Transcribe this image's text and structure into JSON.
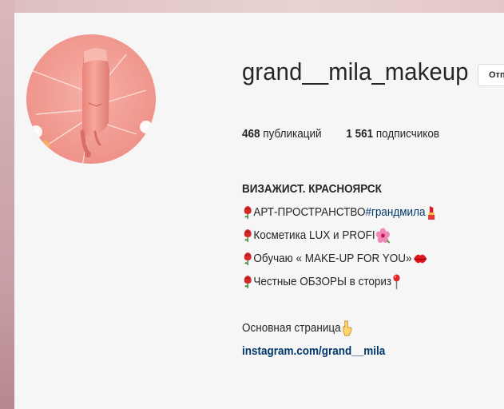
{
  "profile": {
    "username": "grand__mila_makeup",
    "message_button_label": "Отп"
  },
  "stats": {
    "posts_count": "468",
    "posts_label": " публикаций",
    "followers_count": "1 561",
    "followers_label": " подписчиков"
  },
  "bio": {
    "name": "ВИЗАЖИСТ. КРАСНОЯРСК",
    "lines": [
      {
        "text": "АРТ-ПРОСТРАНСТВО ",
        "hashtag": "#грандмила",
        "trailing_icon": "lipstick-icon"
      },
      {
        "text": "Косметика LUX и PROFI",
        "trailing_icon": "hibiscus-icon"
      },
      {
        "text": "Обучаю « MAKE-UP FOR YOU»",
        "trailing_icon": "kiss-icon"
      },
      {
        "text": "Честные ОБЗОРЫ в сториз",
        "trailing_icon": "pin-icon"
      }
    ],
    "main_page_text": "Основная страница",
    "link": "instagram.com/grand__mila"
  },
  "colors": {
    "link": "#00376b",
    "text": "#262626",
    "panel": "#f7f6f6"
  }
}
